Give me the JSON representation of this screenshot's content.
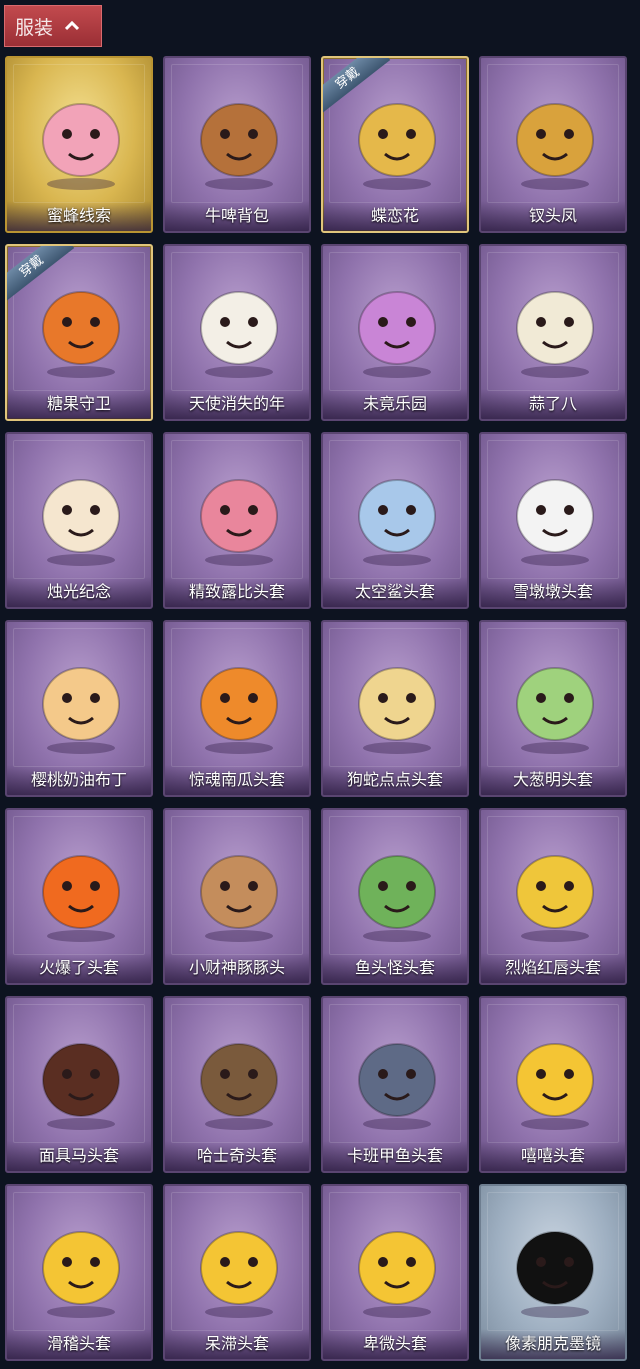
{
  "section": {
    "label": "服装"
  },
  "equipped_badge": "穿戴",
  "items": [
    {
      "name": "蜜蜂线索",
      "style": "gold",
      "equipped": false,
      "icon": "bee-costume-icon",
      "color": "#f2a3b8"
    },
    {
      "name": "牛啤背包",
      "style": "purple",
      "equipped": false,
      "icon": "beer-barrel-icon",
      "color": "#b5713a"
    },
    {
      "name": "蝶恋花",
      "style": "purple",
      "equipped": true,
      "icon": "bell-wreath-icon",
      "color": "#e5b84a"
    },
    {
      "name": "钗头凤",
      "style": "purple",
      "equipped": false,
      "icon": "phoenix-crown-icon",
      "color": "#d9a23c"
    },
    {
      "name": "糖果守卫",
      "style": "purple",
      "equipped": true,
      "icon": "pumpkin-charm-icon",
      "color": "#e8782a"
    },
    {
      "name": "天使消失的年",
      "style": "purple",
      "equipped": false,
      "icon": "angel-doll-icon",
      "color": "#f3efe6"
    },
    {
      "name": "未竟乐园",
      "style": "purple",
      "equipped": false,
      "icon": "star-girl-icon",
      "color": "#c985d6"
    },
    {
      "name": "蒜了八",
      "style": "purple",
      "equipped": false,
      "icon": "garlic-icon",
      "color": "#f1ead6"
    },
    {
      "name": "烛光纪念",
      "style": "purple",
      "equipped": false,
      "icon": "candle-icon",
      "color": "#f5e6cf"
    },
    {
      "name": "精致露比头套",
      "style": "purple",
      "equipped": false,
      "icon": "pink-beaver-head-icon",
      "color": "#e9869c"
    },
    {
      "name": "太空鲨头套",
      "style": "purple",
      "equipped": false,
      "icon": "shark-head-icon",
      "color": "#a8c8ea"
    },
    {
      "name": "雪墩墩头套",
      "style": "purple",
      "equipped": false,
      "icon": "snowman-head-icon",
      "color": "#f3f3f3"
    },
    {
      "name": "樱桃奶油布丁",
      "style": "purple",
      "equipped": false,
      "icon": "pudding-icon",
      "color": "#f4c98a"
    },
    {
      "name": "惊魂南瓜头套",
      "style": "purple",
      "equipped": false,
      "icon": "pumpkin-head-icon",
      "color": "#ee8a2b"
    },
    {
      "name": "狗蛇点点头套",
      "style": "purple",
      "equipped": false,
      "icon": "snake-head-icon",
      "color": "#efd58f"
    },
    {
      "name": "大葱明头套",
      "style": "purple",
      "equipped": false,
      "icon": "bok-choy-icon",
      "color": "#9fd27d"
    },
    {
      "name": "火爆了头套",
      "style": "purple",
      "equipped": false,
      "icon": "fire-head-icon",
      "color": "#f06a1f"
    },
    {
      "name": "小财神豚豚头",
      "style": "purple",
      "equipped": false,
      "icon": "capybara-head-icon",
      "color": "#c48d5c"
    },
    {
      "name": "鱼头怪头套",
      "style": "purple",
      "equipped": false,
      "icon": "fish-mask-icon",
      "color": "#6fb25a"
    },
    {
      "name": "烈焰红唇头套",
      "style": "purple",
      "equipped": false,
      "icon": "yellow-mask-icon",
      "color": "#efc63a"
    },
    {
      "name": "面具马头套",
      "style": "purple",
      "equipped": false,
      "icon": "horse-mask-icon",
      "color": "#5a2e22"
    },
    {
      "name": "哈士奇头套",
      "style": "purple",
      "equipped": false,
      "icon": "husky-head-icon",
      "color": "#7a5a3c"
    },
    {
      "name": "卡班甲鱼头套",
      "style": "purple",
      "equipped": false,
      "icon": "fish-head-icon",
      "color": "#5e6a86"
    },
    {
      "name": "嘻嘻头套",
      "style": "purple",
      "equipped": false,
      "icon": "grin-emoji-icon",
      "color": "#f4c534"
    },
    {
      "name": "滑稽头套",
      "style": "purple",
      "equipped": false,
      "icon": "smirk-emoji-icon",
      "color": "#f4c534"
    },
    {
      "name": "呆滞头套",
      "style": "purple",
      "equipped": false,
      "icon": "stare-emoji-icon",
      "color": "#f4c534"
    },
    {
      "name": "卑微头套",
      "style": "purple",
      "equipped": false,
      "icon": "shy-emoji-icon",
      "color": "#f4c534"
    },
    {
      "name": "像素朋克墨镜",
      "style": "gray",
      "equipped": false,
      "icon": "pixel-sunglasses-icon",
      "color": "#111111"
    }
  ]
}
